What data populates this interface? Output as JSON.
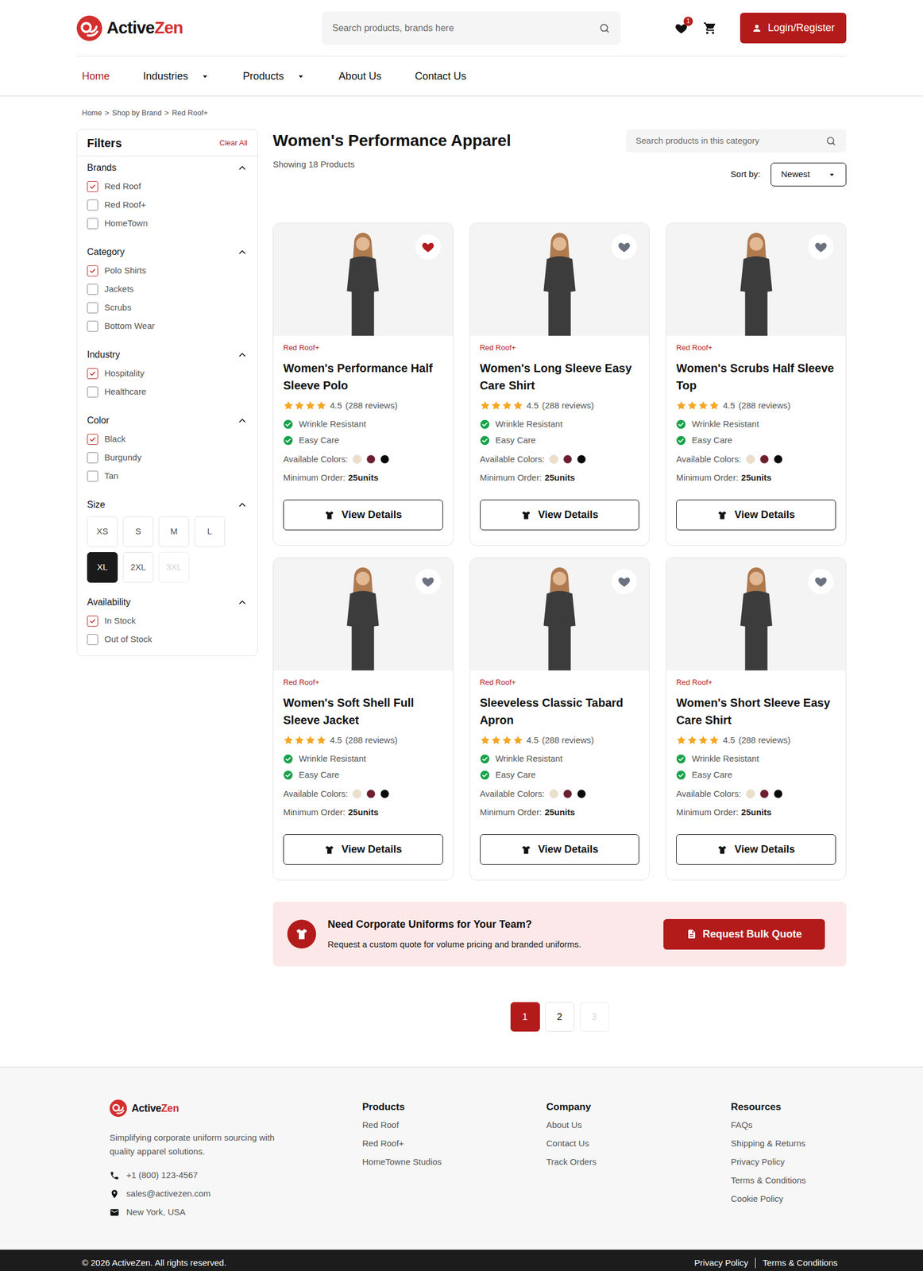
{
  "logo": {
    "primary": "Active",
    "accent": "Zen"
  },
  "header": {
    "search": {
      "placeholder": "Search products, brands here"
    },
    "wishlist_count": "1",
    "login": "Login/Register"
  },
  "nav": [
    {
      "label": "Home",
      "selected": true,
      "dropdown": false
    },
    {
      "label": "Industries",
      "selected": false,
      "dropdown": true
    },
    {
      "label": "Products",
      "selected": false,
      "dropdown": true
    },
    {
      "label": "About Us",
      "selected": false,
      "dropdown": false
    },
    {
      "label": "Contact Us",
      "selected": false,
      "dropdown": false
    }
  ],
  "breadcrumb": {
    "items": [
      "Home",
      "Shop by Brand",
      "Red Roof+"
    ],
    "separator": ">"
  },
  "filters": {
    "title": "Filters",
    "clear": "Clear All",
    "groups": [
      {
        "title": "Brands",
        "kind": "checkbox",
        "expanded": true,
        "options": [
          {
            "label": "Red Roof",
            "checked": true
          },
          {
            "label": "Red Roof+",
            "checked": false
          },
          {
            "label": "HomeTown",
            "checked": false
          }
        ]
      },
      {
        "title": "Category",
        "kind": "checkbox",
        "expanded": true,
        "options": [
          {
            "label": "Polo Shirts",
            "checked": true
          },
          {
            "label": "Jackets",
            "checked": false
          },
          {
            "label": "Scrubs",
            "checked": false
          },
          {
            "label": "Bottom Wear",
            "checked": false
          }
        ]
      },
      {
        "title": "Industry",
        "kind": "checkbox",
        "expanded": true,
        "options": [
          {
            "label": "Hospitality",
            "checked": true
          },
          {
            "label": "Healthcare",
            "checked": false
          }
        ]
      },
      {
        "title": "Color",
        "kind": "checkbox",
        "expanded": true,
        "options": [
          {
            "label": "Black",
            "checked": true
          },
          {
            "label": "Burgundy",
            "checked": false
          },
          {
            "label": "Tan",
            "checked": false
          }
        ]
      },
      {
        "title": "Size",
        "kind": "size",
        "expanded": true,
        "options": [
          {
            "label": "XS",
            "selected": false,
            "disabled": false
          },
          {
            "label": "S",
            "selected": false,
            "disabled": false
          },
          {
            "label": "M",
            "selected": false,
            "disabled": false
          },
          {
            "label": "L",
            "selected": false,
            "disabled": false
          },
          {
            "label": "XL",
            "selected": true,
            "disabled": false
          },
          {
            "label": "2XL",
            "selected": false,
            "disabled": false
          },
          {
            "label": "3XL",
            "selected": false,
            "disabled": true
          }
        ]
      },
      {
        "title": "Availability",
        "kind": "checkbox",
        "expanded": true,
        "options": [
          {
            "label": "In Stock",
            "checked": true
          },
          {
            "label": "Out of Stock",
            "checked": false
          }
        ]
      }
    ]
  },
  "listing": {
    "title": "Women's Performance Apparel",
    "count": "Showing 18 Products",
    "search": {
      "placeholder": "Search products in this category"
    },
    "sort": {
      "label": "Sort by:",
      "value": "Newest"
    }
  },
  "products": [
    {
      "brand": "Red Roof+",
      "name": "Women's Performance Half Sleeve Polo",
      "stars": 4,
      "rating": "4.5",
      "reviews": "(288 reviews)",
      "features": [
        "Wrinkle Resistant",
        "Easy Care"
      ],
      "colors_label": "Available Colors:",
      "colors": [
        {
          "color": "#ecdfca"
        },
        {
          "color": "#6d1f2f"
        },
        {
          "color": "#0a0a0a"
        }
      ],
      "min_label": "Minimum Order:",
      "min_value": "25units",
      "button": "View Details",
      "favorite": true
    },
    {
      "brand": "Red Roof+",
      "name": "Women's Long Sleeve Easy Care Shirt",
      "stars": 4,
      "rating": "4.5",
      "reviews": "(288 reviews)",
      "features": [
        "Wrinkle Resistant",
        "Easy Care"
      ],
      "colors_label": "Available Colors:",
      "colors": [
        {
          "color": "#ecdfca"
        },
        {
          "color": "#6d1f2f"
        },
        {
          "color": "#0a0a0a"
        }
      ],
      "min_label": "Minimum Order:",
      "min_value": "25units",
      "button": "View Details",
      "favorite": false
    },
    {
      "brand": "Red Roof+",
      "name": "Women's Scrubs Half Sleeve Top",
      "stars": 4,
      "rating": "4.5",
      "reviews": "(288 reviews)",
      "features": [
        "Wrinkle Resistant",
        "Easy Care"
      ],
      "colors_label": "Available Colors:",
      "colors": [
        {
          "color": "#ecdfca"
        },
        {
          "color": "#6d1f2f"
        },
        {
          "color": "#0a0a0a"
        }
      ],
      "min_label": "Minimum Order:",
      "min_value": "25units",
      "button": "View Details",
      "favorite": false
    },
    {
      "brand": "Red Roof+",
      "name": "Women's Soft Shell Full Sleeve Jacket",
      "stars": 4,
      "rating": "4.5",
      "reviews": "(288 reviews)",
      "features": [
        "Wrinkle Resistant",
        "Easy Care"
      ],
      "colors_label": "Available Colors:",
      "colors": [
        {
          "color": "#ecdfca"
        },
        {
          "color": "#6d1f2f"
        },
        {
          "color": "#0a0a0a"
        }
      ],
      "min_label": "Minimum Order:",
      "min_value": "25units",
      "button": "View Details",
      "favorite": false
    },
    {
      "brand": "Red Roof+",
      "name": "Sleeveless Classic Tabard Apron",
      "stars": 4,
      "rating": "4.5",
      "reviews": "(288 reviews)",
      "features": [
        "Wrinkle Resistant",
        "Easy Care"
      ],
      "colors_label": "Available Colors:",
      "colors": [
        {
          "color": "#ecdfca"
        },
        {
          "color": "#6d1f2f"
        },
        {
          "color": "#0a0a0a"
        }
      ],
      "min_label": "Minimum Order:",
      "min_value": "25units",
      "button": "View Details",
      "favorite": false
    },
    {
      "brand": "Red Roof+",
      "name": "Women's Short Sleeve Easy Care Shirt",
      "stars": 4,
      "rating": "4.5",
      "reviews": "(288 reviews)",
      "features": [
        "Wrinkle Resistant",
        "Easy Care"
      ],
      "colors_label": "Available Colors:",
      "colors": [
        {
          "color": "#ecdfca"
        },
        {
          "color": "#6d1f2f"
        },
        {
          "color": "#0a0a0a"
        }
      ],
      "min_label": "Minimum Order:",
      "min_value": "25units",
      "button": "View Details",
      "favorite": false
    }
  ],
  "banner": {
    "title": "Need Corporate Uniforms for Your Team?",
    "text": "Request a custom quote for volume pricing and branded uniforms.",
    "button": "Request Bulk Quote"
  },
  "pagination": [
    {
      "label": "1",
      "selected": true,
      "disabled": false
    },
    {
      "label": "2",
      "selected": false,
      "disabled": false
    },
    {
      "label": "3",
      "selected": false,
      "disabled": true
    }
  ],
  "footer": {
    "tagline": "Simplifying corporate uniform sourcing with quality apparel solutions.",
    "contacts": [
      {
        "kind": "phone",
        "text": "+1 (800) 123-4567"
      },
      {
        "kind": "pin",
        "text": "sales@activezen.com"
      },
      {
        "kind": "mail",
        "text": "New York, USA"
      }
    ],
    "columns": [
      {
        "title": "Products",
        "links": [
          "Red Roof",
          "Red Roof+",
          "HomeTowne Studios"
        ]
      },
      {
        "title": "Company",
        "links": [
          "About Us",
          "Contact Us",
          "Track Orders"
        ]
      },
      {
        "title": "Resources",
        "links": [
          "FAQs",
          "Shipping & Returns",
          "Privacy Policy",
          "Terms & Conditions",
          "Cookie Policy"
        ]
      }
    ],
    "copyright": "© 2026 ActiveZen. All rights reserved.",
    "legal": [
      "Privacy Policy",
      "Terms & Conditions"
    ]
  }
}
